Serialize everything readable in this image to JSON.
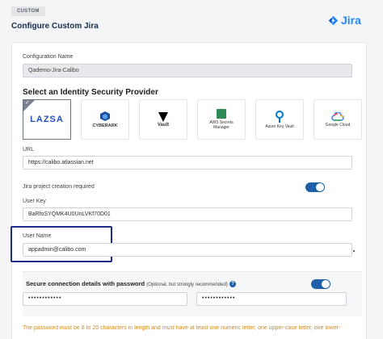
{
  "header": {
    "tag": "CUSTOM",
    "title": "Configure Custom Jira",
    "brand": "Jira"
  },
  "form": {
    "config_name_label": "Configuration Name",
    "config_name_value": "Qademo-Jira-Calibo",
    "provider_section_title": "Select an Identity Security Provider",
    "providers": [
      {
        "name": "LAZSA",
        "selected": true
      },
      {
        "name": "CYBERARK",
        "selected": false
      },
      {
        "name": "Vault",
        "selected": false
      },
      {
        "name": "AWS Secrets Manager",
        "selected": false
      },
      {
        "name": "Azure Key Vault",
        "selected": false
      },
      {
        "name": "Google Cloud",
        "selected": false
      }
    ],
    "url_label": "URL",
    "url_value": "https://calibo.atlassian.net",
    "project_creation_label": "Jira project creation required",
    "user_key_label": "User Key",
    "user_key_value": "BaRfoSYQMK4U0UnLVKf70D01",
    "user_name_label": "User Name",
    "user_name_value": "appadmin@calibo.com",
    "secure_title": "Secure connection details with password",
    "secure_optional": "(Optional, but strongly recommended)",
    "password_value": "••••••••••••",
    "confirm_password_value": "••••••••••••",
    "note": "The password must be 8 to 20 characters in length and must have at least one numeric letter, one upper-case letter, one lower-"
  },
  "colors": {
    "accent": "#1f5fa8",
    "highlight_box": "#1c2a8c",
    "warning_text": "#d08a1a",
    "jira_blue": "#2684ff"
  }
}
